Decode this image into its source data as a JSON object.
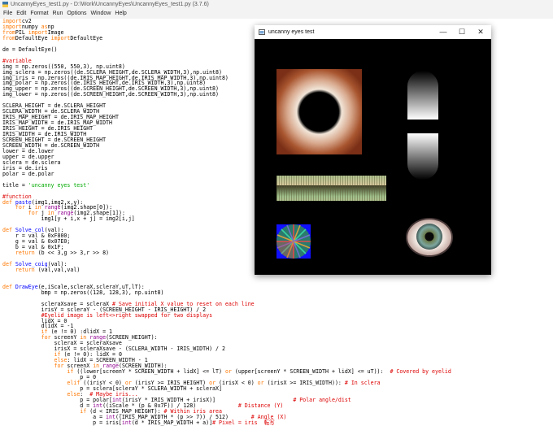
{
  "window_title": "UncannyEyes_test1.py - D:\\Work\\UncannyEyes\\UncannyEyes_test1.py (3.7.6)",
  "menu": [
    "File",
    "Edit",
    "Format",
    "Run",
    "Options",
    "Window",
    "Help"
  ],
  "code_lines": [
    [
      [
        "kw",
        "import"
      ],
      [
        "",
        "cv2"
      ]
    ],
    [
      [
        "kw",
        "import"
      ],
      [
        "",
        "numpy "
      ],
      [
        "kw",
        "as"
      ],
      [
        "",
        "np"
      ]
    ],
    [
      [
        "kw",
        "from"
      ],
      [
        "",
        "PIL "
      ],
      [
        "kw",
        "import"
      ],
      [
        "",
        "Image"
      ]
    ],
    [
      [
        "kw",
        "from"
      ],
      [
        "",
        "DefaultEye "
      ],
      [
        "kw",
        "import"
      ],
      [
        "",
        "DefaultEye"
      ]
    ],
    [],
    [
      [
        "",
        "de = DefaultEye()"
      ]
    ],
    [],
    [
      [
        "cm",
        "#variable"
      ]
    ],
    [
      [
        "",
        "img = np.zeros((550, 550,3), np.uint8)"
      ]
    ],
    [
      [
        "",
        "img_sclera = np.zeros((de.SCLERA_HEIGHT,de.SCLERA_WIDTH,3),np.uint8)"
      ]
    ],
    [
      [
        "",
        "img_iris = np.zeros((de.IRIS_MAP_HEIGHT,de.IRIS_MAP_WIDTH,3),np.uint8)"
      ]
    ],
    [
      [
        "",
        "img_polar = np.zeros((de.IRIS_HEIGHT,de.IRIS_WIDTH,3),np.uint8)"
      ]
    ],
    [
      [
        "",
        "img_upper = np.zeros((de.SCREEN_HEIGHT,de.SCREEN_WIDTH,3),np.uint8)"
      ]
    ],
    [
      [
        "",
        "img_lower = np.zeros((de.SCREEN_HEIGHT,de.SCREEN_WIDTH,3),np.uint8)"
      ]
    ],
    [],
    [
      [
        "",
        "SCLERA_HEIGHT = de.SCLERA_HEIGHT"
      ]
    ],
    [
      [
        "",
        "SCLERA_WIDTH = de.SCLERA_WIDTH"
      ]
    ],
    [
      [
        "",
        "IRIS_MAP_HEIGHT = de.IRIS_MAP_HEIGHT"
      ]
    ],
    [
      [
        "",
        "IRIS_MAP_WIDTH = de.IRIS_MAP_WIDTH"
      ]
    ],
    [
      [
        "",
        "IRIS_HEIGHT = de.IRIS_HEIGHT"
      ]
    ],
    [
      [
        "",
        "IRIS_WIDTH = de.IRIS_WIDTH"
      ]
    ],
    [
      [
        "",
        "SCREEN_HEIGHT = de.SCREEN_HEIGHT"
      ]
    ],
    [
      [
        "",
        "SCREEN_WIDTH = de.SCREEN_WIDTH"
      ]
    ],
    [
      [
        "",
        "lower = de.lower"
      ]
    ],
    [
      [
        "",
        "upper = de.upper"
      ]
    ],
    [
      [
        "",
        "sclera = de.sclera"
      ]
    ],
    [
      [
        "",
        "iris = de.iris"
      ]
    ],
    [
      [
        "",
        "polar = de.polar"
      ]
    ],
    [],
    [
      [
        "",
        "title = "
      ],
      [
        "st",
        "'uncanny eyes test'"
      ]
    ],
    [],
    [
      [
        "cm",
        "#function"
      ]
    ],
    [
      [
        "kw",
        "def "
      ],
      [
        "df",
        "paste"
      ],
      [
        "",
        "(img1,img2,x,y):"
      ]
    ],
    [
      [
        "",
        "    "
      ],
      [
        "kw",
        "for"
      ],
      [
        "",
        " i "
      ],
      [
        "kw",
        "in"
      ],
      [
        "",
        " "
      ],
      [
        "bi",
        "range"
      ],
      [
        "",
        "(img2.shape[0]):"
      ]
    ],
    [
      [
        "",
        "        "
      ],
      [
        "kw",
        "for"
      ],
      [
        "",
        " j "
      ],
      [
        "kw",
        "in"
      ],
      [
        "",
        " "
      ],
      [
        "bi",
        "range"
      ],
      [
        "",
        "(img2.shape[1]):"
      ]
    ],
    [
      [
        "",
        "            img1[y + i,x + j] = img2[i,j]"
      ]
    ],
    [],
    [
      [
        "kw",
        "def "
      ],
      [
        "df",
        "Solve_col"
      ],
      [
        "",
        "(val):"
      ]
    ],
    [
      [
        "",
        "    r = val & 0xF800;"
      ]
    ],
    [
      [
        "",
        "    g = val & 0x07E0;"
      ]
    ],
    [
      [
        "",
        "    b = val & 0x1F;"
      ]
    ],
    [
      [
        "",
        "    "
      ],
      [
        "kw",
        "return"
      ],
      [
        "",
        " (b << 3,g >> 3,r >> 8)"
      ]
    ],
    [],
    [
      [
        "kw",
        "def "
      ],
      [
        "df",
        "Solve_coig"
      ],
      [
        "",
        "(val):"
      ]
    ],
    [
      [
        "",
        "    "
      ],
      [
        "kw",
        "return"
      ],
      [
        "",
        " (val,val,val)"
      ]
    ],
    [],
    [],
    [
      [
        "kw",
        "def "
      ],
      [
        "df",
        "DrawEye"
      ],
      [
        "",
        "(e,iScale,scleraX,scleraY,uT,lT):"
      ]
    ],
    [
      [
        "",
        "            bmp = np.zeros((128, 128,3), np.uint8)"
      ]
    ],
    [],
    [
      [
        "",
        "            scleraXsave = scleraX "
      ],
      [
        "cm",
        "# Save initial X value to reset on each line"
      ]
    ],
    [
      [
        "",
        "            irisY = scleraY - (SCREEN_HEIGHT - IRIS_HEIGHT) / 2"
      ]
    ],
    [
      [
        "",
        "            "
      ],
      [
        "cm",
        "#Eyelid image is left<>right swapped for two displays"
      ]
    ],
    [
      [
        "",
        "            lidX = 0"
      ]
    ],
    [
      [
        "",
        "            dlidX = -1"
      ]
    ],
    [
      [
        "",
        "            "
      ],
      [
        "kw",
        "if"
      ],
      [
        "",
        " (e != 0) :dlidX = 1"
      ]
    ],
    [
      [
        "",
        "            "
      ],
      [
        "kw",
        "for"
      ],
      [
        "",
        " screenY "
      ],
      [
        "kw",
        "in"
      ],
      [
        "",
        ""
      ],
      [
        "bi",
        " range"
      ],
      [
        "",
        "(SCREEN_HEIGHT):"
      ]
    ],
    [
      [
        "",
        "                scleraX = scleraXsave"
      ]
    ],
    [
      [
        "",
        "                irisX = scleraXsave - (SCLERA_WIDTH - IRIS_WIDTH) / 2"
      ]
    ],
    [
      [
        "",
        "                "
      ],
      [
        "kw",
        "if"
      ],
      [
        "",
        " (e != 0): lidX = 0"
      ]
    ],
    [
      [
        "",
        "                "
      ],
      [
        "kw",
        "else"
      ],
      [
        "",
        ": lidX = SCREEN_WIDTH - 1"
      ]
    ],
    [
      [
        "",
        "                "
      ],
      [
        "kw",
        "for"
      ],
      [
        "",
        " screenX "
      ],
      [
        "kw",
        "in"
      ],
      [
        "",
        ""
      ],
      [
        "bi",
        " range"
      ],
      [
        "",
        "(SCREEN_WIDTH):"
      ]
    ],
    [
      [
        "",
        "                    "
      ],
      [
        "kw",
        "if"
      ],
      [
        "",
        " ((lower[screenY * SCREEN_WIDTH + lidX] <= lT) "
      ],
      [
        "kw",
        "or"
      ],
      [
        "",
        " (upper[screenY * SCREEN_WIDTH + lidX] <= uT)):  "
      ],
      [
        "cm",
        "# Covered by eyelid"
      ]
    ],
    [
      [
        "",
        "                        p = 0"
      ]
    ],
    [
      [
        "",
        "                    "
      ],
      [
        "kw",
        "elif"
      ],
      [
        "",
        " ((irisY < 0) "
      ],
      [
        "kw",
        "or"
      ],
      [
        "",
        " (irisY >= IRIS_HEIGHT) "
      ],
      [
        "kw",
        "or"
      ],
      [
        "",
        " (irisX < 0) "
      ],
      [
        "kw",
        "or"
      ],
      [
        "",
        " (irisX >= IRIS_WIDTH)): "
      ],
      [
        "cm",
        "# In sclera"
      ]
    ],
    [
      [
        "",
        "                        p = sclera[scleraY * SCLERA_WIDTH + scleraX]"
      ]
    ],
    [
      [
        "",
        "                    "
      ],
      [
        "kw",
        "else"
      ],
      [
        "",
        ":  "
      ],
      [
        "cm",
        "# Maybe iris..."
      ]
    ],
    [
      [
        "",
        "                        p = polar["
      ],
      [
        "bi",
        "int"
      ],
      [
        "",
        "(irisY * IRIS_WIDTH + irisX)]                        "
      ],
      [
        "cm",
        "# Polar angle/dist"
      ]
    ],
    [
      [
        "",
        "                        d = "
      ],
      [
        "bi",
        "int"
      ],
      [
        "",
        "((iScale * (p & 0x7F)) / 128)             "
      ],
      [
        "cm",
        "# Distance (Y)"
      ]
    ],
    [
      [
        "",
        "                        "
      ],
      [
        "kw",
        "if"
      ],
      [
        "",
        " (d < IRIS_MAP_HEIGHT): "
      ],
      [
        "cm",
        "# Within iris area"
      ]
    ],
    [
      [
        "",
        "                            a = "
      ],
      [
        "bi",
        "int"
      ],
      [
        "",
        "((IRIS_MAP_WIDTH * (p >> 7)) / 512)       "
      ],
      [
        "cm",
        "# Angle (X)"
      ]
    ],
    [
      [
        "",
        "                            p = iris["
      ],
      [
        "bi",
        "int"
      ],
      [
        "",
        "(d * IRIS_MAP_WIDTH + a)]"
      ],
      [
        "cm",
        "# Pixel = iris  転写"
      ]
    ]
  ],
  "preview_window": {
    "title": "uncanny eyes test",
    "minimize": "—",
    "maximize": "☐",
    "close": "✕"
  }
}
